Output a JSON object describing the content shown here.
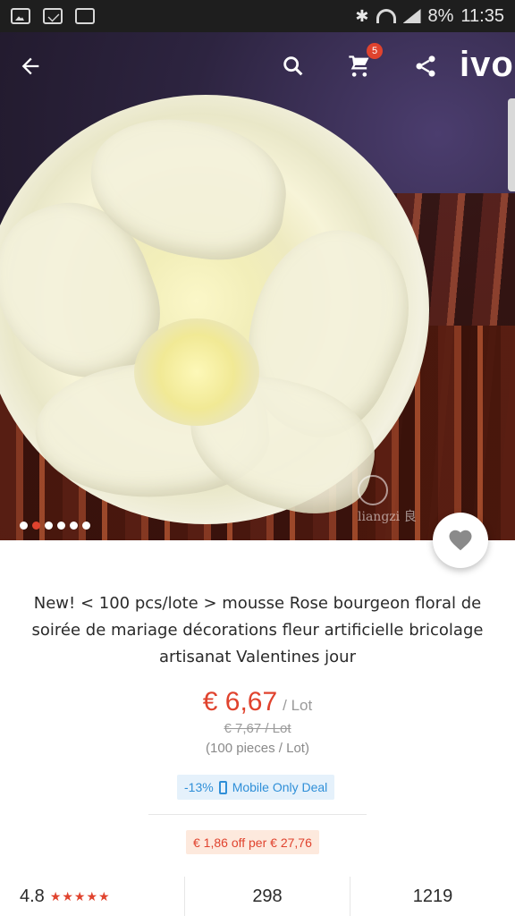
{
  "status_bar": {
    "battery": "8%",
    "time": "11:35",
    "icons": [
      "image-icon",
      "mail-icon",
      "screenshot-icon",
      "bluetooth-icon",
      "wifi-icon",
      "signal-icon"
    ]
  },
  "toolbar": {
    "cart_count": "5",
    "brand_partial": "ivo",
    "icons": [
      "back-arrow-icon",
      "search-icon",
      "cart-icon",
      "share-icon"
    ]
  },
  "gallery": {
    "total_images": 6,
    "active_index": 1,
    "watermark": "liangzi 良"
  },
  "product": {
    "title": "New! < 100 pcs/lote > mousse Rose bourgeon floral de soirée de mariage décorations fleur artificielle bricolage artisanat Valentines jour",
    "price": "€ 6,67",
    "price_unit": "/ Lot",
    "old_price": "€ 7,67 / Lot",
    "pieces": "(100 pieces / Lot)",
    "deal_discount": "-13%",
    "deal_label": "Mobile Only Deal",
    "coupon": "€ 1,86 off per € 27,76"
  },
  "stats": {
    "rating": "4.8",
    "stars": "★★★★★",
    "stars_count": 5,
    "reviews": "298",
    "orders": "1219"
  },
  "colors": {
    "accent": "#e0432e",
    "deal_blue": "#2f8fd8",
    "deal_bg": "#e5f1fb",
    "coupon_bg": "#fde9dd"
  }
}
